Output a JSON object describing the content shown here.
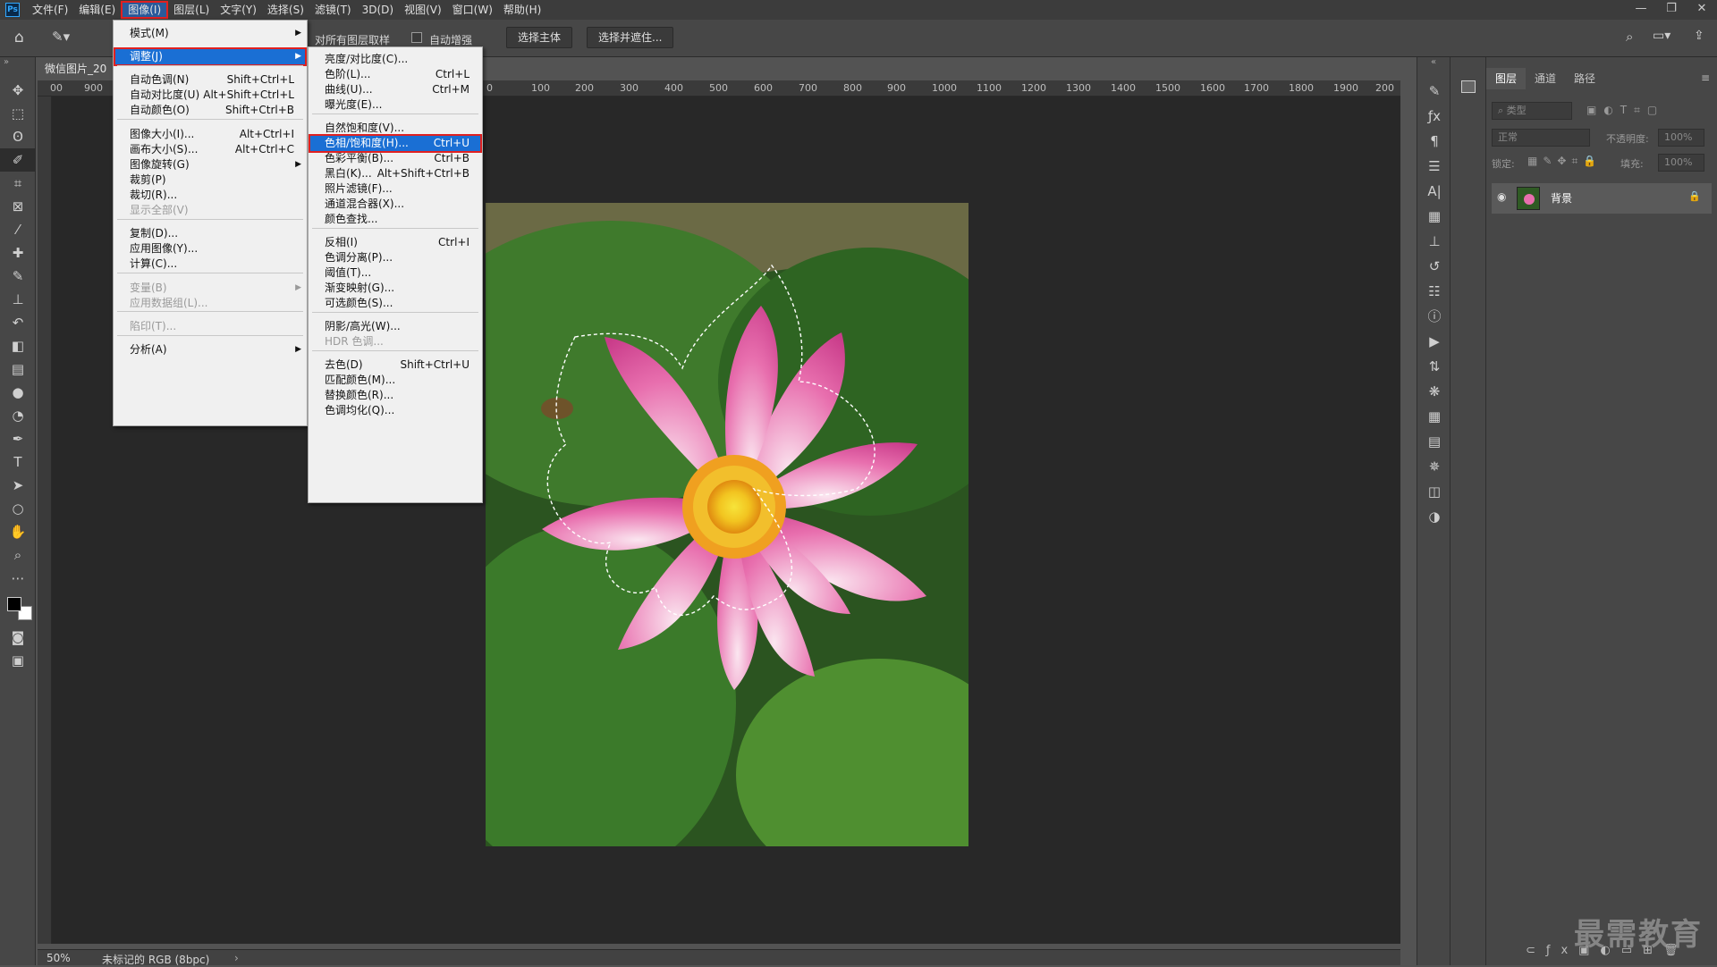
{
  "menubar": {
    "app_logo": "Ps",
    "items": [
      "文件(F)",
      "编辑(E)",
      "图像(I)",
      "图层(L)",
      "文字(Y)",
      "选择(S)",
      "滤镜(T)",
      "3D(D)",
      "视图(V)",
      "窗口(W)",
      "帮助(H)"
    ],
    "active_index": 2,
    "window_controls": [
      "—",
      "❐",
      "✕"
    ]
  },
  "options_bar": {
    "sample_all_layers": "对所有图层取样",
    "auto_enhance": "自动增强",
    "select_subject": "选择主体",
    "select_and_mask": "选择并遮住..."
  },
  "document": {
    "tab_title": "微信图片_20",
    "ruler_labels": [
      "00",
      "900",
      "0",
      "100",
      "200",
      "300",
      "400",
      "500",
      "600",
      "700",
      "800",
      "900",
      "1000",
      "1100",
      "1200",
      "1300",
      "1400",
      "1500",
      "1600",
      "1700",
      "1800",
      "1900",
      "200"
    ],
    "zoom": "50%",
    "color_profile": "未标记的 RGB (8bpc)"
  },
  "image_menu": {
    "items": [
      {
        "label": "模式(M)",
        "shortcut": "",
        "submenu": true,
        "disabled": false
      },
      {
        "label": "调整(J)",
        "shortcut": "",
        "submenu": true,
        "disabled": false,
        "highlight": true
      },
      {
        "label": "自动色调(N)",
        "shortcut": "Shift+Ctrl+L",
        "submenu": false,
        "disabled": false
      },
      {
        "label": "自动对比度(U)",
        "shortcut": "Alt+Shift+Ctrl+L",
        "submenu": false,
        "disabled": false
      },
      {
        "label": "自动颜色(O)",
        "shortcut": "Shift+Ctrl+B",
        "submenu": false,
        "disabled": false
      },
      {
        "label": "图像大小(I)...",
        "shortcut": "Alt+Ctrl+I",
        "submenu": false,
        "disabled": false
      },
      {
        "label": "画布大小(S)...",
        "shortcut": "Alt+Ctrl+C",
        "submenu": false,
        "disabled": false
      },
      {
        "label": "图像旋转(G)",
        "shortcut": "",
        "submenu": true,
        "disabled": false
      },
      {
        "label": "裁剪(P)",
        "shortcut": "",
        "submenu": false,
        "disabled": false
      },
      {
        "label": "裁切(R)...",
        "shortcut": "",
        "submenu": false,
        "disabled": false
      },
      {
        "label": "显示全部(V)",
        "shortcut": "",
        "submenu": false,
        "disabled": true
      },
      {
        "label": "复制(D)...",
        "shortcut": "",
        "submenu": false,
        "disabled": false
      },
      {
        "label": "应用图像(Y)...",
        "shortcut": "",
        "submenu": false,
        "disabled": false
      },
      {
        "label": "计算(C)...",
        "shortcut": "",
        "submenu": false,
        "disabled": false
      },
      {
        "label": "变量(B)",
        "shortcut": "",
        "submenu": true,
        "disabled": true
      },
      {
        "label": "应用数据组(L)...",
        "shortcut": "",
        "submenu": false,
        "disabled": true
      },
      {
        "label": "陷印(T)...",
        "shortcut": "",
        "submenu": false,
        "disabled": true
      },
      {
        "label": "分析(A)",
        "shortcut": "",
        "submenu": true,
        "disabled": false
      }
    ]
  },
  "adjust_menu": {
    "items": [
      {
        "label": "亮度/对比度(C)...",
        "shortcut": ""
      },
      {
        "label": "色阶(L)...",
        "shortcut": "Ctrl+L"
      },
      {
        "label": "曲线(U)...",
        "shortcut": "Ctrl+M"
      },
      {
        "label": "曝光度(E)...",
        "shortcut": ""
      },
      {
        "label": "自然饱和度(V)...",
        "shortcut": ""
      },
      {
        "label": "色相/饱和度(H)...",
        "shortcut": "Ctrl+U",
        "highlight": true
      },
      {
        "label": "色彩平衡(B)...",
        "shortcut": "Ctrl+B"
      },
      {
        "label": "黑白(K)...",
        "shortcut": "Alt+Shift+Ctrl+B"
      },
      {
        "label": "照片滤镜(F)...",
        "shortcut": ""
      },
      {
        "label": "通道混合器(X)...",
        "shortcut": ""
      },
      {
        "label": "颜色查找...",
        "shortcut": ""
      },
      {
        "label": "反相(I)",
        "shortcut": "Ctrl+I"
      },
      {
        "label": "色调分离(P)...",
        "shortcut": ""
      },
      {
        "label": "阈值(T)...",
        "shortcut": ""
      },
      {
        "label": "渐变映射(G)...",
        "shortcut": ""
      },
      {
        "label": "可选颜色(S)...",
        "shortcut": ""
      },
      {
        "label": "阴影/高光(W)...",
        "shortcut": ""
      },
      {
        "label": "HDR 色调...",
        "shortcut": "",
        "disabled": true
      },
      {
        "label": "去色(D)",
        "shortcut": "Shift+Ctrl+U"
      },
      {
        "label": "匹配颜色(M)...",
        "shortcut": ""
      },
      {
        "label": "替换颜色(R)...",
        "shortcut": ""
      },
      {
        "label": "色调均化(Q)...",
        "shortcut": ""
      }
    ]
  },
  "layers_panel": {
    "tabs": [
      "图层",
      "通道",
      "路径"
    ],
    "filter_placeholder": "类型",
    "blend_mode": "正常",
    "opacity_label": "不透明度:",
    "opacity_value": "100%",
    "lock_label": "锁定:",
    "fill_label": "填充:",
    "fill_value": "100%",
    "layer_name": "背景"
  },
  "watermark": "最需教育"
}
